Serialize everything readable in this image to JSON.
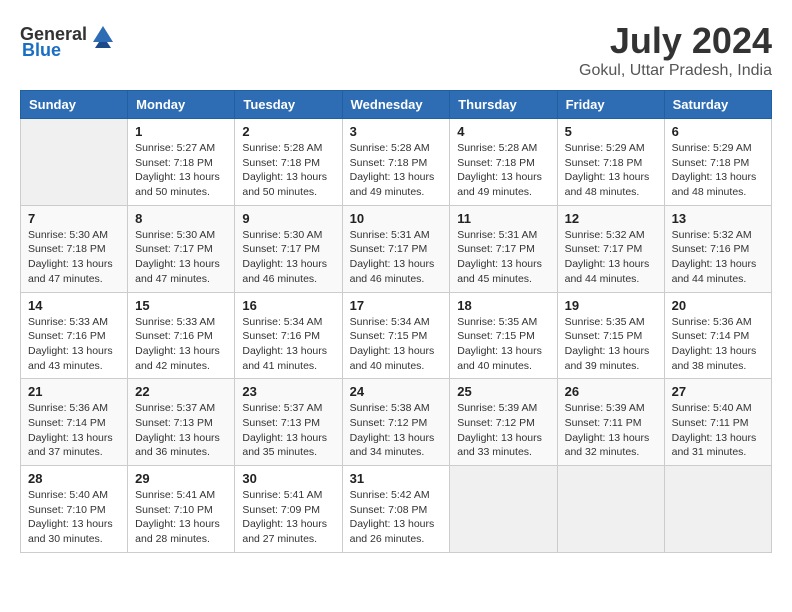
{
  "header": {
    "logo_general": "General",
    "logo_blue": "Blue",
    "title": "July 2024",
    "subtitle": "Gokul, Uttar Pradesh, India"
  },
  "columns": [
    "Sunday",
    "Monday",
    "Tuesday",
    "Wednesday",
    "Thursday",
    "Friday",
    "Saturday"
  ],
  "weeks": [
    [
      {
        "day": "",
        "sunrise": "",
        "sunset": "",
        "daylight": ""
      },
      {
        "day": "1",
        "sunrise": "Sunrise: 5:27 AM",
        "sunset": "Sunset: 7:18 PM",
        "daylight": "Daylight: 13 hours and 50 minutes."
      },
      {
        "day": "2",
        "sunrise": "Sunrise: 5:28 AM",
        "sunset": "Sunset: 7:18 PM",
        "daylight": "Daylight: 13 hours and 50 minutes."
      },
      {
        "day": "3",
        "sunrise": "Sunrise: 5:28 AM",
        "sunset": "Sunset: 7:18 PM",
        "daylight": "Daylight: 13 hours and 49 minutes."
      },
      {
        "day": "4",
        "sunrise": "Sunrise: 5:28 AM",
        "sunset": "Sunset: 7:18 PM",
        "daylight": "Daylight: 13 hours and 49 minutes."
      },
      {
        "day": "5",
        "sunrise": "Sunrise: 5:29 AM",
        "sunset": "Sunset: 7:18 PM",
        "daylight": "Daylight: 13 hours and 48 minutes."
      },
      {
        "day": "6",
        "sunrise": "Sunrise: 5:29 AM",
        "sunset": "Sunset: 7:18 PM",
        "daylight": "Daylight: 13 hours and 48 minutes."
      }
    ],
    [
      {
        "day": "7",
        "sunrise": "Sunrise: 5:30 AM",
        "sunset": "Sunset: 7:18 PM",
        "daylight": "Daylight: 13 hours and 47 minutes."
      },
      {
        "day": "8",
        "sunrise": "Sunrise: 5:30 AM",
        "sunset": "Sunset: 7:17 PM",
        "daylight": "Daylight: 13 hours and 47 minutes."
      },
      {
        "day": "9",
        "sunrise": "Sunrise: 5:30 AM",
        "sunset": "Sunset: 7:17 PM",
        "daylight": "Daylight: 13 hours and 46 minutes."
      },
      {
        "day": "10",
        "sunrise": "Sunrise: 5:31 AM",
        "sunset": "Sunset: 7:17 PM",
        "daylight": "Daylight: 13 hours and 46 minutes."
      },
      {
        "day": "11",
        "sunrise": "Sunrise: 5:31 AM",
        "sunset": "Sunset: 7:17 PM",
        "daylight": "Daylight: 13 hours and 45 minutes."
      },
      {
        "day": "12",
        "sunrise": "Sunrise: 5:32 AM",
        "sunset": "Sunset: 7:17 PM",
        "daylight": "Daylight: 13 hours and 44 minutes."
      },
      {
        "day": "13",
        "sunrise": "Sunrise: 5:32 AM",
        "sunset": "Sunset: 7:16 PM",
        "daylight": "Daylight: 13 hours and 44 minutes."
      }
    ],
    [
      {
        "day": "14",
        "sunrise": "Sunrise: 5:33 AM",
        "sunset": "Sunset: 7:16 PM",
        "daylight": "Daylight: 13 hours and 43 minutes."
      },
      {
        "day": "15",
        "sunrise": "Sunrise: 5:33 AM",
        "sunset": "Sunset: 7:16 PM",
        "daylight": "Daylight: 13 hours and 42 minutes."
      },
      {
        "day": "16",
        "sunrise": "Sunrise: 5:34 AM",
        "sunset": "Sunset: 7:16 PM",
        "daylight": "Daylight: 13 hours and 41 minutes."
      },
      {
        "day": "17",
        "sunrise": "Sunrise: 5:34 AM",
        "sunset": "Sunset: 7:15 PM",
        "daylight": "Daylight: 13 hours and 40 minutes."
      },
      {
        "day": "18",
        "sunrise": "Sunrise: 5:35 AM",
        "sunset": "Sunset: 7:15 PM",
        "daylight": "Daylight: 13 hours and 40 minutes."
      },
      {
        "day": "19",
        "sunrise": "Sunrise: 5:35 AM",
        "sunset": "Sunset: 7:15 PM",
        "daylight": "Daylight: 13 hours and 39 minutes."
      },
      {
        "day": "20",
        "sunrise": "Sunrise: 5:36 AM",
        "sunset": "Sunset: 7:14 PM",
        "daylight": "Daylight: 13 hours and 38 minutes."
      }
    ],
    [
      {
        "day": "21",
        "sunrise": "Sunrise: 5:36 AM",
        "sunset": "Sunset: 7:14 PM",
        "daylight": "Daylight: 13 hours and 37 minutes."
      },
      {
        "day": "22",
        "sunrise": "Sunrise: 5:37 AM",
        "sunset": "Sunset: 7:13 PM",
        "daylight": "Daylight: 13 hours and 36 minutes."
      },
      {
        "day": "23",
        "sunrise": "Sunrise: 5:37 AM",
        "sunset": "Sunset: 7:13 PM",
        "daylight": "Daylight: 13 hours and 35 minutes."
      },
      {
        "day": "24",
        "sunrise": "Sunrise: 5:38 AM",
        "sunset": "Sunset: 7:12 PM",
        "daylight": "Daylight: 13 hours and 34 minutes."
      },
      {
        "day": "25",
        "sunrise": "Sunrise: 5:39 AM",
        "sunset": "Sunset: 7:12 PM",
        "daylight": "Daylight: 13 hours and 33 minutes."
      },
      {
        "day": "26",
        "sunrise": "Sunrise: 5:39 AM",
        "sunset": "Sunset: 7:11 PM",
        "daylight": "Daylight: 13 hours and 32 minutes."
      },
      {
        "day": "27",
        "sunrise": "Sunrise: 5:40 AM",
        "sunset": "Sunset: 7:11 PM",
        "daylight": "Daylight: 13 hours and 31 minutes."
      }
    ],
    [
      {
        "day": "28",
        "sunrise": "Sunrise: 5:40 AM",
        "sunset": "Sunset: 7:10 PM",
        "daylight": "Daylight: 13 hours and 30 minutes."
      },
      {
        "day": "29",
        "sunrise": "Sunrise: 5:41 AM",
        "sunset": "Sunset: 7:10 PM",
        "daylight": "Daylight: 13 hours and 28 minutes."
      },
      {
        "day": "30",
        "sunrise": "Sunrise: 5:41 AM",
        "sunset": "Sunset: 7:09 PM",
        "daylight": "Daylight: 13 hours and 27 minutes."
      },
      {
        "day": "31",
        "sunrise": "Sunrise: 5:42 AM",
        "sunset": "Sunset: 7:08 PM",
        "daylight": "Daylight: 13 hours and 26 minutes."
      },
      {
        "day": "",
        "sunrise": "",
        "sunset": "",
        "daylight": ""
      },
      {
        "day": "",
        "sunrise": "",
        "sunset": "",
        "daylight": ""
      },
      {
        "day": "",
        "sunrise": "",
        "sunset": "",
        "daylight": ""
      }
    ]
  ]
}
